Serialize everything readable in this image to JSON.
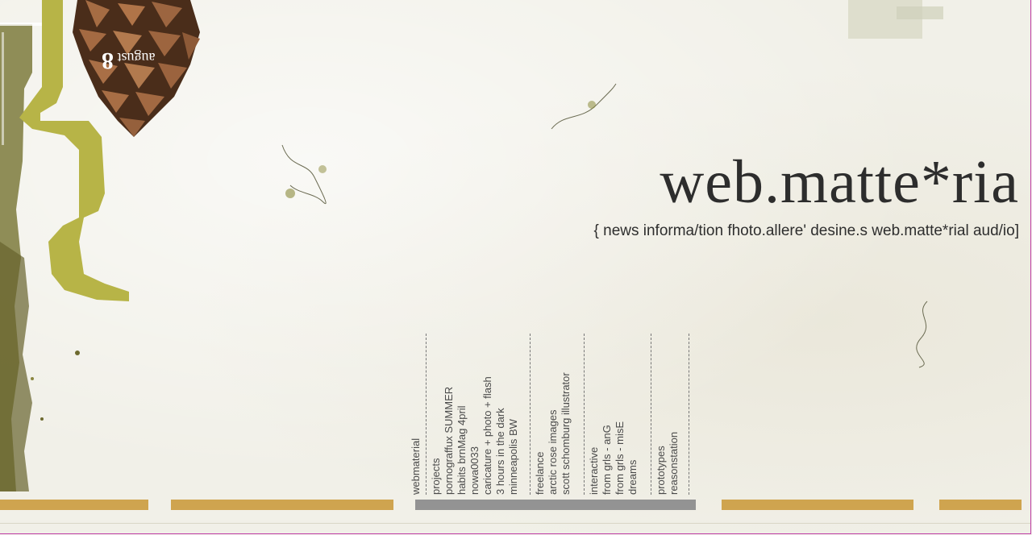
{
  "header": {
    "brand": "web.matte*ria",
    "tagline": "{ news informa/tion fhoto.allere' desine.s web.matte*rial aud/io]"
  },
  "decor": {
    "date_label": "august",
    "date_number": "8"
  },
  "menu": {
    "columns": [
      {
        "items": [
          "webmaterial"
        ]
      },
      {
        "items": [
          "projects",
          "pornograffux SUMMER",
          "habits brnMag 4pril",
          "nowa0033",
          "caricature + photo + flash",
          "3 hours in the dark",
          "minneapolis BW"
        ]
      },
      {
        "items": [
          "freelance",
          "arctic rose images",
          "scott schomburg illustrator"
        ]
      },
      {
        "items": [
          "interactive",
          "from grls - anG",
          "from grls - misE",
          "dreams"
        ]
      },
      {
        "items": [
          "prototypes",
          "reasonstation"
        ]
      }
    ]
  },
  "colors": {
    "background": "#f2f1e9",
    "accent_gold": "#cfa44f",
    "accent_gray": "#939393",
    "olive": "#b7b447",
    "border": "#c03fa8",
    "text": "#2d2d2d"
  },
  "icons": [
    "pinecone-image",
    "olive-bracket-graphic"
  ]
}
